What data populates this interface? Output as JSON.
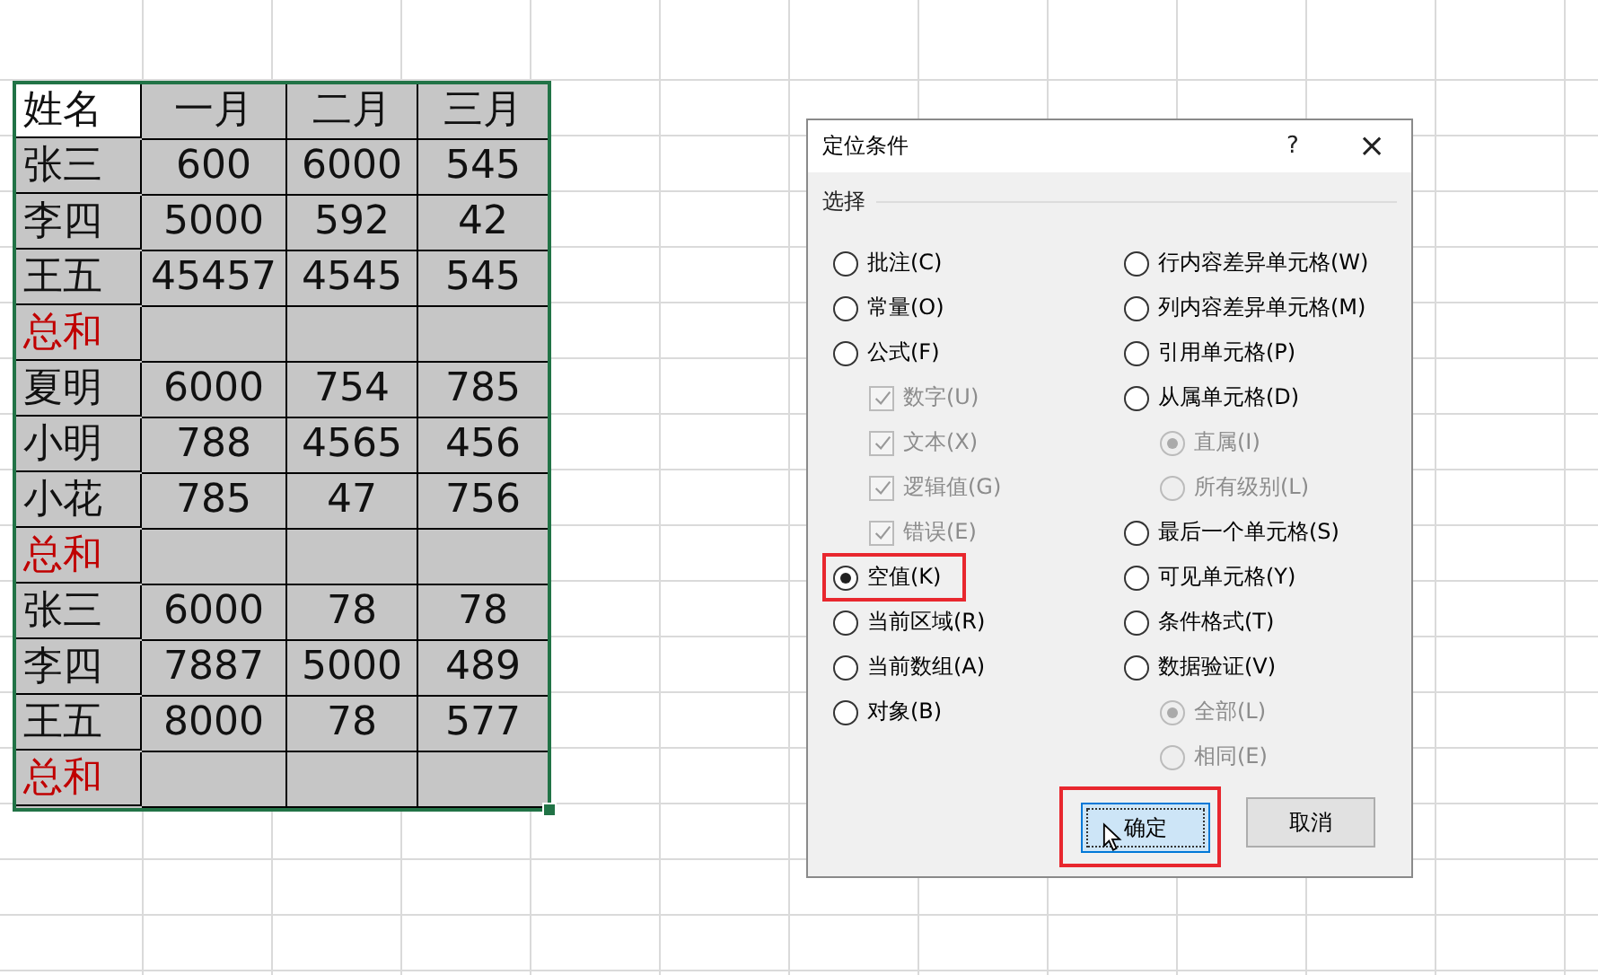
{
  "sheet": {
    "columns": [
      {
        "label": "姓名",
        "active": true
      },
      {
        "label": "一月",
        "active": false
      },
      {
        "label": "二月",
        "active": false
      },
      {
        "label": "三月",
        "active": false
      }
    ],
    "rows": [
      {
        "kind": "data",
        "name": "张三",
        "values": [
          "600",
          "6000",
          "545"
        ]
      },
      {
        "kind": "data",
        "name": "李四",
        "values": [
          "5000",
          "592",
          "42"
        ]
      },
      {
        "kind": "data",
        "name": "王五",
        "values": [
          "45457",
          "4545",
          "545"
        ]
      },
      {
        "kind": "total",
        "name": "总和"
      },
      {
        "kind": "data",
        "name": "夏明",
        "values": [
          "6000",
          "754",
          "785"
        ]
      },
      {
        "kind": "data",
        "name": "小明",
        "values": [
          "788",
          "4565",
          "456"
        ]
      },
      {
        "kind": "data",
        "name": "小花",
        "values": [
          "785",
          "47",
          "756"
        ]
      },
      {
        "kind": "total",
        "name": "总和"
      },
      {
        "kind": "data",
        "name": "张三",
        "values": [
          "6000",
          "78",
          "78"
        ]
      },
      {
        "kind": "data",
        "name": "李四",
        "values": [
          "7887",
          "5000",
          "489"
        ]
      },
      {
        "kind": "data",
        "name": "王五",
        "values": [
          "8000",
          "78",
          "577"
        ]
      },
      {
        "kind": "total",
        "name": "总和"
      }
    ]
  },
  "dialog": {
    "title": "定位条件",
    "help": "?",
    "close": "×",
    "group_label": "选择",
    "left": [
      {
        "kind": "radio",
        "label": "批注(C)",
        "selected": false,
        "disabled": false,
        "highlighted": false
      },
      {
        "kind": "radio",
        "label": "常量(O)",
        "selected": false,
        "disabled": false,
        "highlighted": false
      },
      {
        "kind": "radio",
        "label": "公式(F)",
        "selected": false,
        "disabled": false,
        "highlighted": false
      },
      {
        "kind": "check",
        "label": "数字(U)",
        "checked": true,
        "disabled": true
      },
      {
        "kind": "check",
        "label": "文本(X)",
        "checked": true,
        "disabled": true
      },
      {
        "kind": "check",
        "label": "逻辑值(G)",
        "checked": true,
        "disabled": true
      },
      {
        "kind": "check",
        "label": "错误(E)",
        "checked": true,
        "disabled": true
      },
      {
        "kind": "radio",
        "label": "空值(K)",
        "selected": true,
        "disabled": false,
        "highlighted": true
      },
      {
        "kind": "radio",
        "label": "当前区域(R)",
        "selected": false,
        "disabled": false,
        "highlighted": false
      },
      {
        "kind": "radio",
        "label": "当前数组(A)",
        "selected": false,
        "disabled": false,
        "highlighted": false
      },
      {
        "kind": "radio",
        "label": "对象(B)",
        "selected": false,
        "disabled": false,
        "highlighted": false
      }
    ],
    "right": [
      {
        "kind": "radio",
        "label": "行内容差异单元格(W)",
        "selected": false,
        "disabled": false,
        "highlighted": false
      },
      {
        "kind": "radio",
        "label": "列内容差异单元格(M)",
        "selected": false,
        "disabled": false,
        "highlighted": false
      },
      {
        "kind": "radio",
        "label": "引用单元格(P)",
        "selected": false,
        "disabled": false,
        "highlighted": false
      },
      {
        "kind": "radio",
        "label": "从属单元格(D)",
        "selected": false,
        "disabled": false,
        "highlighted": false
      },
      {
        "kind": "subradio",
        "label": "直属(I)",
        "selected": true,
        "disabled": true,
        "highlighted": false
      },
      {
        "kind": "subradio",
        "label": "所有级别(L)",
        "selected": false,
        "disabled": true,
        "highlighted": false
      },
      {
        "kind": "radio",
        "label": "最后一个单元格(S)",
        "selected": false,
        "disabled": false,
        "highlighted": false
      },
      {
        "kind": "radio",
        "label": "可见单元格(Y)",
        "selected": false,
        "disabled": false,
        "highlighted": false
      },
      {
        "kind": "radio",
        "label": "条件格式(T)",
        "selected": false,
        "disabled": false,
        "highlighted": false
      },
      {
        "kind": "radio",
        "label": "数据验证(V)",
        "selected": false,
        "disabled": false,
        "highlighted": false
      },
      {
        "kind": "subradio",
        "label": "全部(L)",
        "selected": true,
        "disabled": true,
        "highlighted": false
      },
      {
        "kind": "subradio",
        "label": "相同(E)",
        "selected": false,
        "disabled": true,
        "highlighted": false
      }
    ],
    "buttons": [
      {
        "label": "确定",
        "focused": true,
        "highlighted": true
      },
      {
        "label": "取消",
        "focused": false
      }
    ]
  }
}
